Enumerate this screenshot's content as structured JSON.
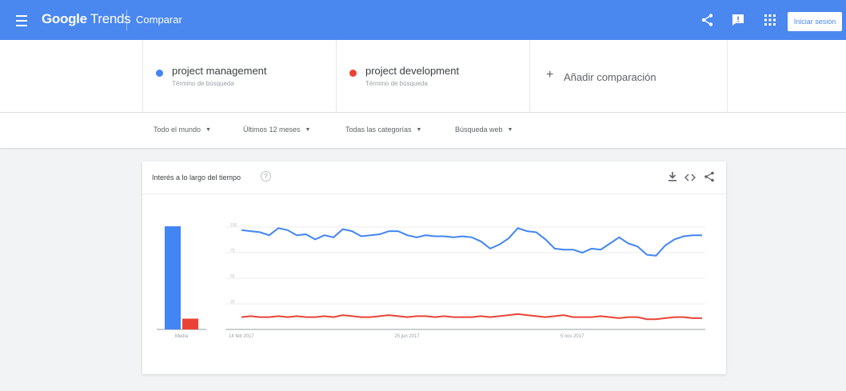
{
  "app": {
    "brand_bold": "Google",
    "brand_rest": " Trends",
    "section": "Comparar",
    "signin_label": "Iniciar sesión"
  },
  "terms": [
    {
      "name": "project management",
      "subtitle": "Término de búsqueda",
      "color": "#4285f4"
    },
    {
      "name": "project development",
      "subtitle": "Término de búsqueda",
      "color": "#ea4335"
    }
  ],
  "add_comparison": {
    "label": "Añadir comparación"
  },
  "filters": [
    {
      "label": "Todo el mundo"
    },
    {
      "label": "Últimos 12 meses"
    },
    {
      "label": "Todas las categorías"
    },
    {
      "label": "Búsqueda web"
    }
  ],
  "card": {
    "title": "Interés a lo largo del tiempo"
  },
  "icons": {
    "menu": "hamburger-menu-icon",
    "share": "share-icon",
    "feedback": "feedback-icon",
    "apps": "apps-grid-icon",
    "help": "help-icon",
    "download": "download-icon",
    "embed": "embed-icon"
  },
  "chart_data": [
    {
      "type": "bar",
      "categories": [
        "project management",
        "project development"
      ],
      "values": [
        86,
        9
      ],
      "xlabel": "Media",
      "ylim": [
        0,
        100
      ],
      "colors": [
        "#4285f4",
        "#ea4335"
      ]
    },
    {
      "type": "line",
      "x_ticks": [
        "14 feb 2017",
        "25 jun 2017",
        "5 nov 2017"
      ],
      "y_ticks": [
        "100",
        "75",
        "50",
        "25"
      ],
      "ylim": [
        0,
        100
      ],
      "grid": true,
      "series": [
        {
          "name": "project management",
          "color": "#4285f4",
          "values": [
            97,
            96,
            95,
            92,
            99,
            97,
            92,
            93,
            88,
            92,
            90,
            98,
            96,
            91,
            92,
            93,
            96,
            96,
            92,
            90,
            92,
            91,
            91,
            90,
            91,
            90,
            86,
            79,
            83,
            89,
            99,
            96,
            95,
            88,
            79,
            78,
            78,
            75,
            79,
            78,
            84,
            90,
            84,
            81,
            73,
            72,
            82,
            88,
            91,
            92,
            92
          ]
        },
        {
          "name": "project development",
          "color": "#ea4335",
          "values": [
            12,
            13,
            12,
            12,
            13,
            12,
            13,
            12,
            12,
            13,
            12,
            14,
            13,
            12,
            12,
            13,
            14,
            13,
            12,
            13,
            13,
            12,
            13,
            12,
            12,
            12,
            13,
            12,
            13,
            14,
            15,
            14,
            13,
            12,
            13,
            14,
            12,
            12,
            12,
            13,
            12,
            11,
            12,
            12,
            10,
            10,
            11,
            12,
            12,
            11,
            11
          ]
        }
      ]
    }
  ]
}
